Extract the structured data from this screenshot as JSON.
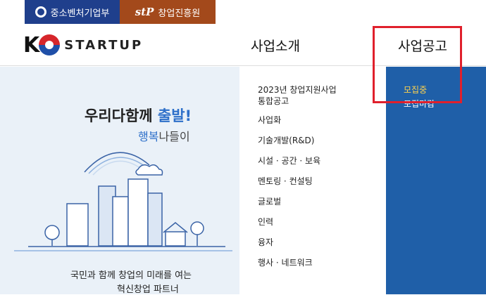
{
  "topbar": {
    "tab1_label": "중소벤처기업부",
    "tab2_logo": "stP",
    "tab2_label": "창업진흥원",
    "color_ministry": "#1f3f8c",
    "color_agency": "#a3491b"
  },
  "header": {
    "brand_k": "K",
    "brand_word": "STARTUP",
    "nav": [
      "사업소개",
      "사업공고"
    ]
  },
  "hero": {
    "headline_part1": "우리다함께 ",
    "headline_highlight": "출발!",
    "sub_highlight": "행복",
    "sub_rest": "나들이",
    "slogan_line1": "국민과 함께 창업의 미래를 여는",
    "slogan_line2": "혁신창업 파트너"
  },
  "submenu": {
    "items": [
      "2023년 창업지원사업",
      "통합공고",
      "사업화",
      "기술개발(R&D)",
      "시설 · 공간 · 보육",
      "멘토링 · 컨설팅",
      "글로벌",
      "인력",
      "융자",
      "행사 · 네트워크"
    ]
  },
  "active_submenu": {
    "items": [
      "모집중",
      "모집마감"
    ],
    "color_bg": "#1f5fa8",
    "color_current": "#ffd34d"
  },
  "highlight_color": "#e0202c"
}
